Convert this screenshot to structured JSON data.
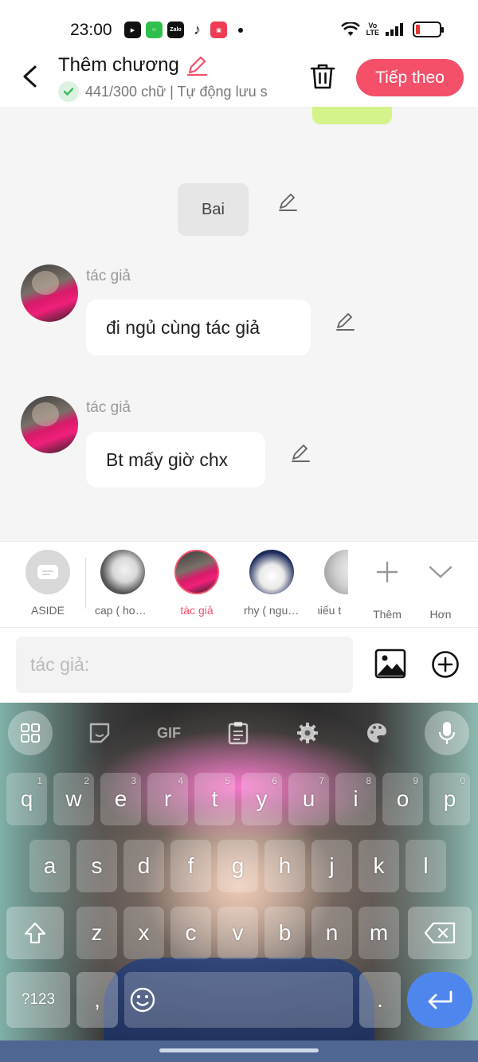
{
  "status_bar": {
    "time": "23:00",
    "app_icons": [
      "game-app-icon",
      "wechat-app-icon",
      "zalo-app-icon",
      "tiktok-app-icon",
      "video-app-icon"
    ],
    "zalo_label": "Zalo",
    "network_label_top": "Vo",
    "network_label_bottom": "LTE",
    "battery_color": "#e53935"
  },
  "header": {
    "title": "Thêm chương",
    "subtitle": "441/300 chữ | Tự động lưu s",
    "next_label": "Tiếp theo",
    "accent_color": "#f4506a"
  },
  "chat": {
    "narration": "Bai",
    "messages": [
      {
        "author": "tác giả",
        "text": "đi ngủ cùng tác giả"
      },
      {
        "author": "tác giả",
        "text": "Bt mấy giờ chx"
      }
    ]
  },
  "characters": {
    "items": [
      {
        "name": "ASIDE"
      },
      {
        "name": "cap ( hoà..."
      },
      {
        "name": "tác giả",
        "active": true
      },
      {
        "name": "rhy ( nguy..."
      },
      {
        "name": "hiếu t"
      }
    ],
    "add_label": "Thêm",
    "more_label": "Hơn"
  },
  "composer": {
    "placeholder": "tác giả:"
  },
  "keyboard": {
    "toolbar": [
      "apps-grid-icon",
      "sticker-icon",
      "GIF",
      "clipboard-icon",
      "settings-gear-icon",
      "palette-icon",
      "microphone-icon"
    ],
    "gif_label": "GIF",
    "row1": [
      {
        "k": "q",
        "h": "1"
      },
      {
        "k": "w",
        "h": "2"
      },
      {
        "k": "e",
        "h": "3"
      },
      {
        "k": "r",
        "h": "4"
      },
      {
        "k": "t",
        "h": "5"
      },
      {
        "k": "y",
        "h": "6"
      },
      {
        "k": "u",
        "h": "7"
      },
      {
        "k": "i",
        "h": "8"
      },
      {
        "k": "o",
        "h": "9"
      },
      {
        "k": "p",
        "h": "0"
      }
    ],
    "row2": [
      "a",
      "s",
      "d",
      "f",
      "g",
      "h",
      "j",
      "k",
      "l"
    ],
    "row3": [
      "z",
      "x",
      "c",
      "v",
      "b",
      "n",
      "m"
    ],
    "numbers_label": "?123",
    "comma_label": ",",
    "period_label": "."
  }
}
